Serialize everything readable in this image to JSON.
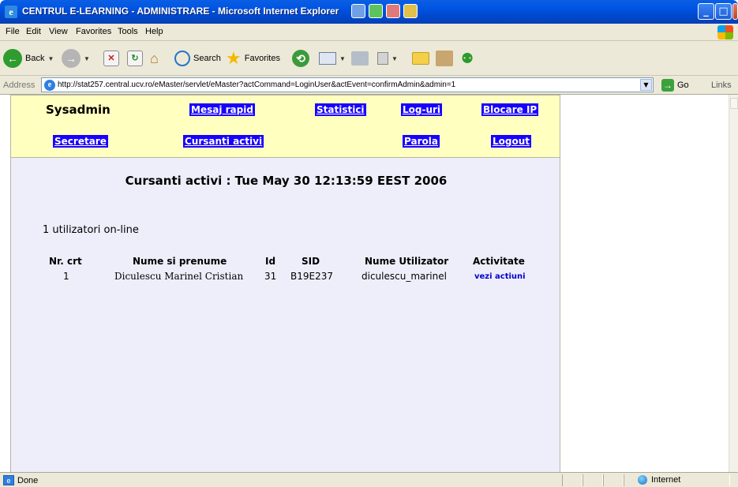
{
  "window": {
    "title": "CENTRUL E-LEARNING - ADMINISTRARE - Microsoft Internet Explorer",
    "app_icon": "ie-icon"
  },
  "menubar": {
    "items": [
      "File",
      "Edit",
      "View",
      "Favorites",
      "Tools",
      "Help"
    ]
  },
  "toolbar": {
    "back_label": "Back",
    "search_label": "Search",
    "favorites_label": "Favorites"
  },
  "address": {
    "label": "Address",
    "url": "http://stat257.central.ucv.ro/eMaster/servlet/eMaster?actCommand=LoginUser&actEvent=confirmAdmin&admin=1",
    "go_label": "Go",
    "links_label": "Links"
  },
  "page": {
    "nav": {
      "title": "Sysadmin",
      "mesaj_rapid": "Mesaj rapid",
      "statistici": "Statistici",
      "log_uri": "Log-uri",
      "blocare_ip": "Blocare IP",
      "secretare": "Secretare",
      "cursanti_activi": "Cursanti activi",
      "parola": "Parola",
      "logout": "Logout"
    },
    "heading": "Cursanti activi : Tue May 30 12:13:59 EEST 2006",
    "online_count": "1 utilizatori on-line",
    "table": {
      "headers": [
        "Nr. crt",
        "Nume si prenume",
        "Id",
        "SID",
        "Nume Utilizator",
        "Activitate"
      ],
      "rows": [
        [
          "1",
          "Diculescu Marinel Cristian",
          "31",
          "B19E237",
          "diculescu_marinel",
          "vezi actiuni"
        ]
      ]
    }
  },
  "statusbar": {
    "status": "Done",
    "zone": "Internet"
  },
  "colors": {
    "title_bar": "#0054e3",
    "chrome": "#ece9d8",
    "nav_background": "#ffffbf",
    "nav_link_background": "#1700ff",
    "main_background": "#eeeefb",
    "action_link": "#0000cc"
  }
}
